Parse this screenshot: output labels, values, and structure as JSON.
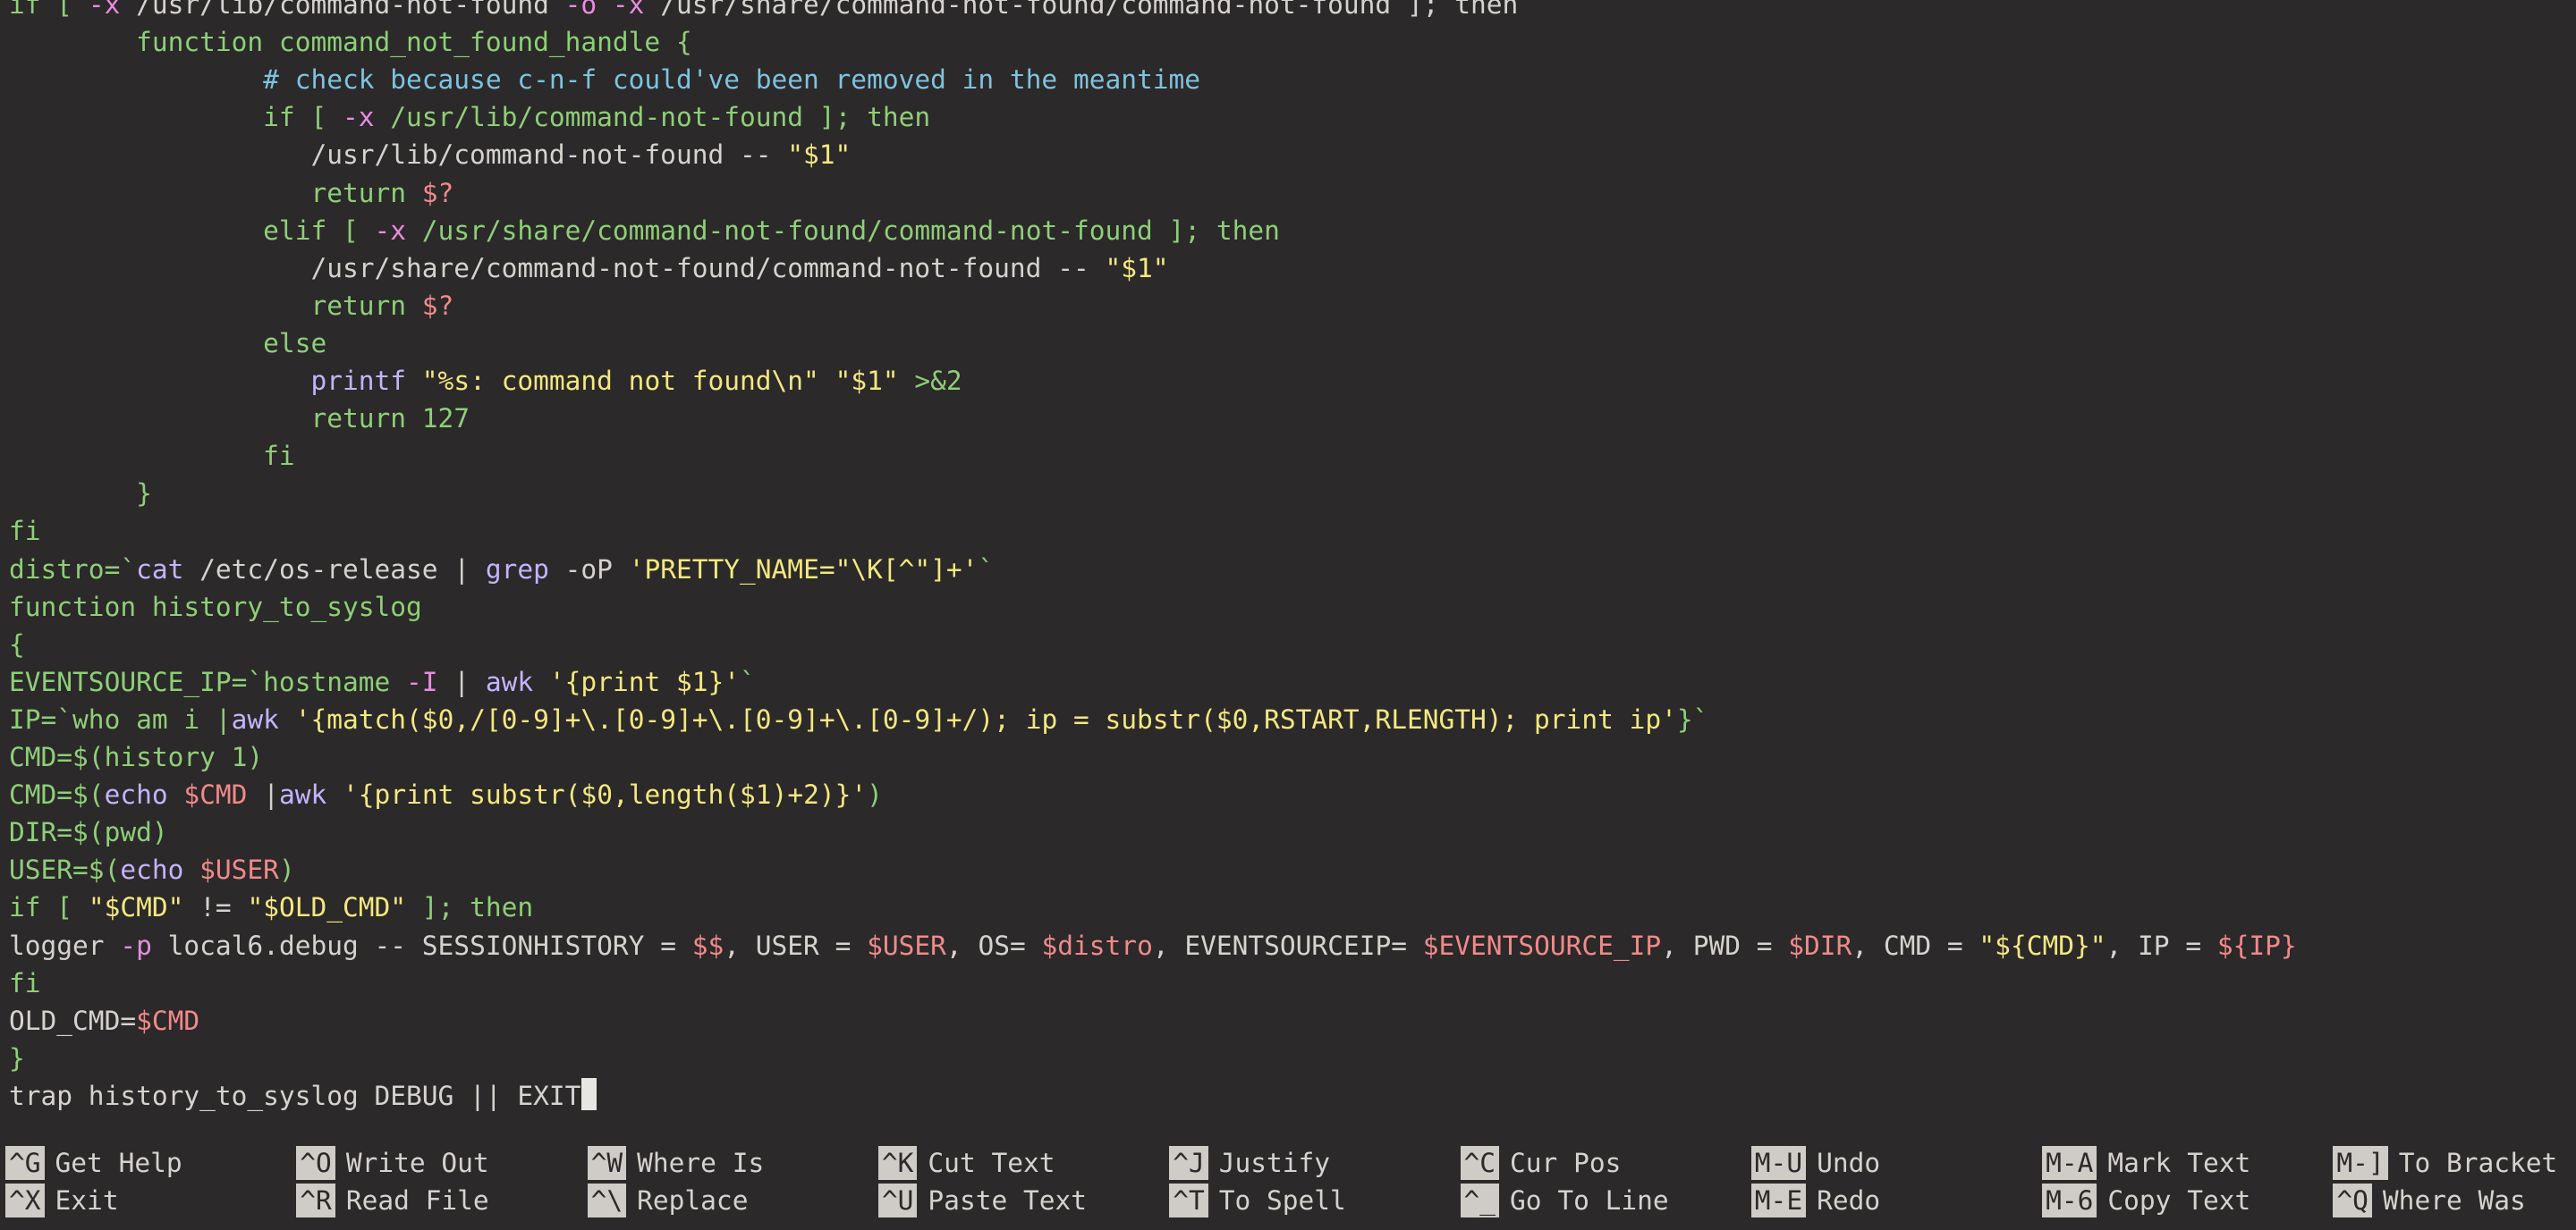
{
  "editor": {
    "lines": [
      [
        {
          "t": "if [ ",
          "c": "kw"
        },
        {
          "t": "-x",
          "c": "opt"
        },
        {
          "t": " /usr/lib/command-not-found ",
          "c": "default"
        },
        {
          "t": "-o -x",
          "c": "opt"
        },
        {
          "t": " /usr/share/command-not-found/command-not-found ]; then",
          "c": "default"
        }
      ],
      [
        {
          "t": "        function command_not_found_handle {",
          "c": "kw"
        }
      ],
      [
        {
          "t": "                # check because c-n-f could've been removed in the meantime",
          "c": "cmt"
        }
      ],
      [
        {
          "t": "                if [ ",
          "c": "kw"
        },
        {
          "t": "-x",
          "c": "opt"
        },
        {
          "t": " /usr/lib/command-not-found ]; then",
          "c": "kw"
        }
      ],
      [
        {
          "t": "                   /usr/lib/command-not-found -- ",
          "c": "default"
        },
        {
          "t": "\"$1\"",
          "c": "str"
        }
      ],
      [
        {
          "t": "                   return ",
          "c": "kw"
        },
        {
          "t": "$?",
          "c": "var"
        }
      ],
      [
        {
          "t": "                elif [ ",
          "c": "kw"
        },
        {
          "t": "-x",
          "c": "opt"
        },
        {
          "t": " /usr/share/command-not-found/command-not-found ]; then",
          "c": "kw"
        }
      ],
      [
        {
          "t": "                   /usr/share/command-not-found/command-not-found -- ",
          "c": "default"
        },
        {
          "t": "\"$1\"",
          "c": "str"
        }
      ],
      [
        {
          "t": "                   return ",
          "c": "kw"
        },
        {
          "t": "$?",
          "c": "var"
        }
      ],
      [
        {
          "t": "                else",
          "c": "kw"
        }
      ],
      [
        {
          "t": "                   ",
          "c": "default"
        },
        {
          "t": "printf",
          "c": "cmd"
        },
        {
          "t": " \"%s: command not found\\n\" \"$1\" ",
          "c": "str"
        },
        {
          "t": ">&2",
          "c": "kw"
        }
      ],
      [
        {
          "t": "                   return 127",
          "c": "kw"
        }
      ],
      [
        {
          "t": "                fi",
          "c": "kw"
        }
      ],
      [
        {
          "t": "        }",
          "c": "kw"
        }
      ],
      [
        {
          "t": "fi",
          "c": "kw"
        }
      ],
      [
        {
          "t": "distro=`",
          "c": "kw"
        },
        {
          "t": "cat",
          "c": "cmd"
        },
        {
          "t": " /etc/os-release | ",
          "c": "default"
        },
        {
          "t": "grep",
          "c": "cmd"
        },
        {
          "t": " -oP ",
          "c": "default"
        },
        {
          "t": "'PRETTY_NAME=\"\\K[^\"]+'",
          "c": "str"
        },
        {
          "t": "`",
          "c": "kw"
        }
      ],
      [
        {
          "t": "function history_to_syslog",
          "c": "kw"
        }
      ],
      [
        {
          "t": "{",
          "c": "kw"
        }
      ],
      [
        {
          "t": "EVENTSOURCE_IP=`hostname ",
          "c": "kw"
        },
        {
          "t": "-I",
          "c": "opt"
        },
        {
          "t": " | ",
          "c": "default"
        },
        {
          "t": "awk",
          "c": "cmd"
        },
        {
          "t": " ",
          "c": "default"
        },
        {
          "t": "'{print $1}'",
          "c": "str"
        },
        {
          "t": "`",
          "c": "kw"
        }
      ],
      [
        {
          "t": "IP=`who am i |",
          "c": "kw"
        },
        {
          "t": "awk",
          "c": "cmd"
        },
        {
          "t": " ",
          "c": "default"
        },
        {
          "t": "'{match($0,/[0-9]+\\.[0-9]+\\.[0-9]+\\.[0-9]+/); ip = substr($0,RSTART,RLENGTH); print ip'",
          "c": "str"
        },
        {
          "t": "}`",
          "c": "kw"
        }
      ],
      [
        {
          "t": "CMD=$(history 1)",
          "c": "kw"
        }
      ],
      [
        {
          "t": "CMD=$(",
          "c": "kw"
        },
        {
          "t": "echo",
          "c": "cmd"
        },
        {
          "t": " ",
          "c": "default"
        },
        {
          "t": "$CMD",
          "c": "var"
        },
        {
          "t": " |",
          "c": "default"
        },
        {
          "t": "awk",
          "c": "cmd"
        },
        {
          "t": " ",
          "c": "default"
        },
        {
          "t": "'{print substr($0,length($1)+2)}'",
          "c": "str"
        },
        {
          "t": ")",
          "c": "kw"
        }
      ],
      [
        {
          "t": "DIR=$(pwd)",
          "c": "kw"
        }
      ],
      [
        {
          "t": "USER=$(",
          "c": "kw"
        },
        {
          "t": "echo",
          "c": "cmd"
        },
        {
          "t": " ",
          "c": "default"
        },
        {
          "t": "$USER",
          "c": "var"
        },
        {
          "t": ")",
          "c": "kw"
        }
      ],
      [
        {
          "t": "if [ ",
          "c": "kw"
        },
        {
          "t": "\"$CMD\"",
          "c": "str"
        },
        {
          "t": " != ",
          "c": "default"
        },
        {
          "t": "\"$OLD_CMD\"",
          "c": "str"
        },
        {
          "t": " ]; then",
          "c": "kw"
        }
      ],
      [
        {
          "t": "logger ",
          "c": "default"
        },
        {
          "t": "-p",
          "c": "opt"
        },
        {
          "t": " local6.debug -- SESSIONHISTORY = ",
          "c": "default"
        },
        {
          "t": "$$",
          "c": "var"
        },
        {
          "t": ", USER = ",
          "c": "default"
        },
        {
          "t": "$USER",
          "c": "var"
        },
        {
          "t": ", OS= ",
          "c": "default"
        },
        {
          "t": "$distro",
          "c": "var"
        },
        {
          "t": ", EVENTSOURCEIP= ",
          "c": "default"
        },
        {
          "t": "$EVENTSOURCE_IP",
          "c": "var"
        },
        {
          "t": ", PWD = ",
          "c": "default"
        },
        {
          "t": "$DIR",
          "c": "var"
        },
        {
          "t": ", CMD = ",
          "c": "default"
        },
        {
          "t": "\"${CMD}\"",
          "c": "str"
        },
        {
          "t": ", IP = ",
          "c": "default"
        },
        {
          "t": "${IP}",
          "c": "var"
        }
      ],
      [
        {
          "t": "fi",
          "c": "kw"
        }
      ],
      [
        {
          "t": "OLD_CMD=",
          "c": "default"
        },
        {
          "t": "$CMD",
          "c": "var"
        }
      ],
      [
        {
          "t": "}",
          "c": "kw"
        }
      ],
      [
        {
          "t": "trap history_to_syslog DEBUG || EXIT",
          "c": "default"
        }
      ]
    ]
  },
  "colors": {
    "background": "#2b2929",
    "keyword": "#8ecf78",
    "comment": "#7ec3e0",
    "string": "#f3e880",
    "variable": "#f08a8a",
    "option": "#e98ce0",
    "command": "#c4b4ff"
  },
  "shortcuts": [
    [
      {
        "key": "^G",
        "label": "Get Help"
      },
      {
        "key": "^X",
        "label": "Exit"
      }
    ],
    [
      {
        "key": "^O",
        "label": "Write Out"
      },
      {
        "key": "^R",
        "label": "Read File"
      }
    ],
    [
      {
        "key": "^W",
        "label": "Where Is"
      },
      {
        "key": "^\\",
        "label": "Replace"
      }
    ],
    [
      {
        "key": "^K",
        "label": "Cut Text"
      },
      {
        "key": "^U",
        "label": "Paste Text"
      }
    ],
    [
      {
        "key": "^J",
        "label": "Justify"
      },
      {
        "key": "^T",
        "label": "To Spell"
      }
    ],
    [
      {
        "key": "^C",
        "label": "Cur Pos"
      },
      {
        "key": "^_",
        "label": "Go To Line"
      }
    ],
    [
      {
        "key": "M-U",
        "label": "Undo"
      },
      {
        "key": "M-E",
        "label": "Redo"
      }
    ],
    [
      {
        "key": "M-A",
        "label": "Mark Text"
      },
      {
        "key": "M-6",
        "label": "Copy Text"
      }
    ],
    [
      {
        "key": "M-]",
        "label": "To Bracket"
      },
      {
        "key": "^Q",
        "label": "Where Was"
      }
    ]
  ]
}
